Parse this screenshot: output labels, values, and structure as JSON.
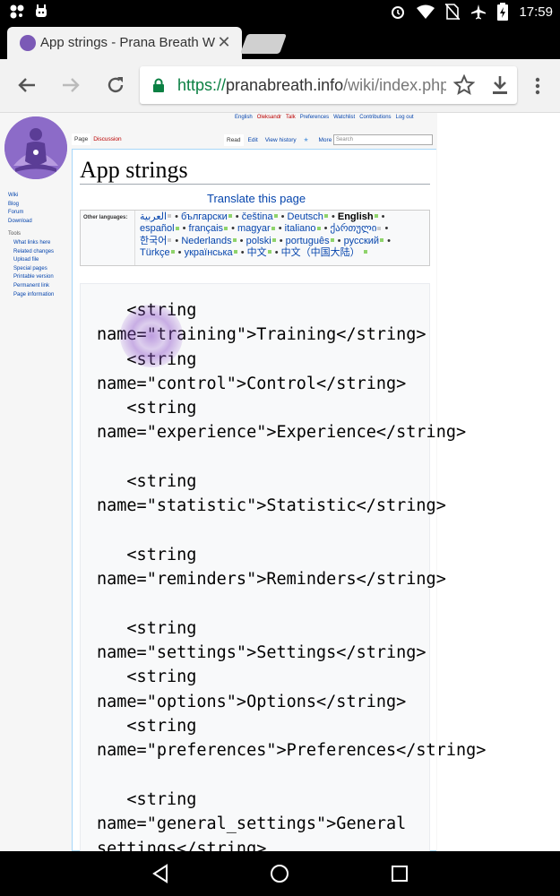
{
  "status_bar": {
    "time": "17:59",
    "icons": [
      "notification-icon",
      "android-icon",
      "alarm-icon",
      "wifi-icon",
      "no-sim-icon",
      "airplane-icon",
      "battery-charging-icon"
    ]
  },
  "browser": {
    "tab": {
      "title": "App strings - Prana Breath W",
      "favicon": "prana-favicon"
    },
    "url": {
      "scheme": "https://",
      "host": "pranabreath.info",
      "path": "/wiki/index.php?"
    }
  },
  "wiki": {
    "personal_tools": [
      "English",
      "Oleksandr",
      "Talk",
      "Preferences",
      "Watchlist",
      "Contributions",
      "Log out"
    ],
    "sidebar": {
      "main": [
        "Wiki",
        "Blog",
        "Forum",
        "Download"
      ],
      "tools_heading": "Tools",
      "tools": [
        "What links here",
        "Related changes",
        "Upload file",
        "Special pages",
        "Printable version",
        "Permanent link",
        "Page information"
      ]
    },
    "page_tabs": {
      "page": "Page",
      "discussion": "Discussion",
      "read": "Read",
      "edit": "Edit",
      "history": "View history",
      "more": "More"
    },
    "search_placeholder": "Search",
    "title": "App strings",
    "translate_link": "Translate this page",
    "other_languages_label": "Other languages:",
    "languages_row1": [
      "العربية",
      "български",
      "čeština",
      "Deutsch",
      "English"
    ],
    "languages_row2": [
      "español",
      "français",
      "magyar",
      "italiano",
      "ქართული"
    ],
    "languages_row3": [
      "한국어",
      "Nederlands",
      "polski",
      "português",
      "русский"
    ],
    "languages_row4": [
      "Türkçe",
      "українська",
      "中文",
      "中文（中国大陆）"
    ],
    "code_lines": [
      "   <string",
      "name=\"training\">Training</string>",
      "   <string",
      "name=\"control\">Control</string>",
      "   <string",
      "name=\"experience\">Experience</string>",
      "",
      "   <string",
      "name=\"statistic\">Statistic</string>",
      "",
      "   <string",
      "name=\"reminders\">Reminders</string>",
      "",
      "   <string",
      "name=\"settings\">Settings</string>",
      "   <string",
      "name=\"options\">Options</string>",
      "   <string",
      "name=\"preferences\">Preferences</string>",
      "",
      "   <string",
      "name=\"general_settings\">General",
      "settings</string>"
    ]
  },
  "navigation": [
    "back-icon",
    "home-icon",
    "recents-icon"
  ]
}
